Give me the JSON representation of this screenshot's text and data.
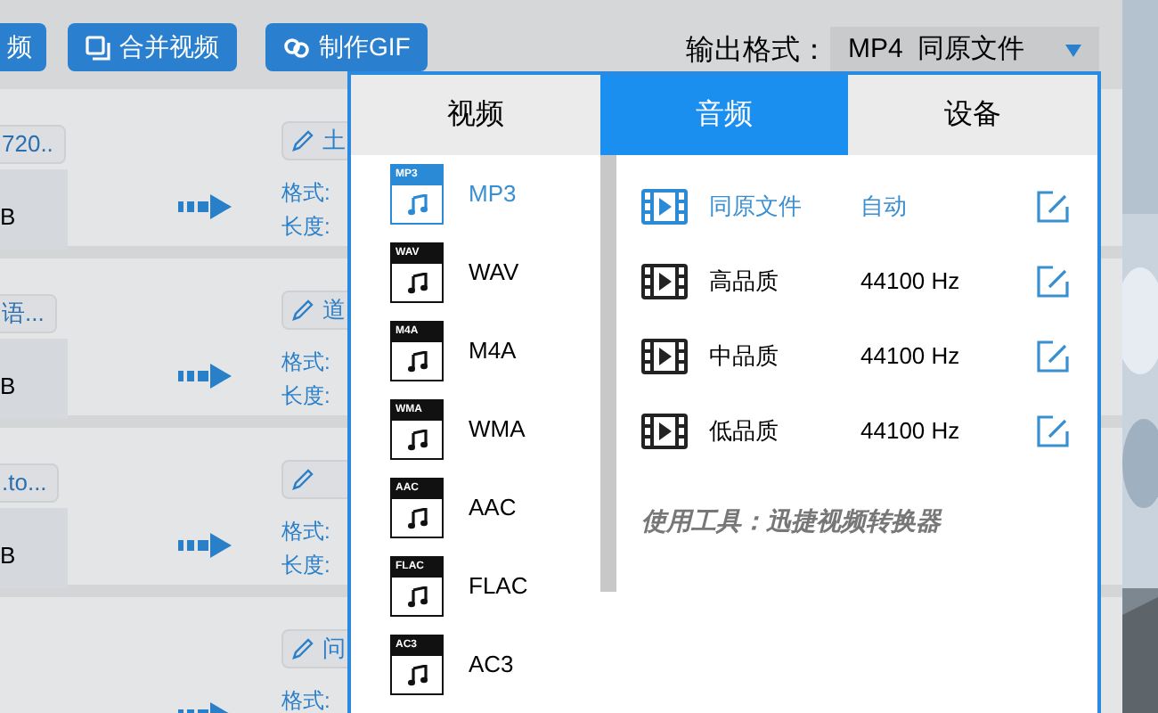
{
  "toolbar": {
    "buttons": [
      {
        "label": "频",
        "kind": "plain"
      },
      {
        "label": "合并视频",
        "kind": "merge"
      },
      {
        "label": "制作GIF",
        "kind": "gif"
      }
    ]
  },
  "output_format": {
    "label": "输出格式：",
    "value": "MP4  同原文件"
  },
  "files": [
    {
      "tag": "720..",
      "size": "B",
      "edit_label": "土",
      "format_label": "格式:",
      "length_label": "长度:"
    },
    {
      "tag": "语...",
      "size": "B",
      "edit_label": "道",
      "format_label": "格式:",
      "length_label": "长度:"
    },
    {
      "tag": ".to...",
      "size": "B",
      "format_label": "格式:",
      "length_label": "长度:"
    },
    {
      "edit_label": "问",
      "format_label": "格式:"
    }
  ],
  "popup": {
    "tabs": [
      {
        "label": "视频",
        "selected": false
      },
      {
        "label": "音频",
        "selected": true
      },
      {
        "label": "设备",
        "selected": false
      }
    ],
    "formats": [
      {
        "label": "MP3",
        "badge": "MP3",
        "selected": true
      },
      {
        "label": "WAV",
        "badge": "WAV",
        "selected": false
      },
      {
        "label": "M4A",
        "badge": "M4A",
        "selected": false
      },
      {
        "label": "WMA",
        "badge": "WMA",
        "selected": false
      },
      {
        "label": "AAC",
        "badge": "AAC",
        "selected": false
      },
      {
        "label": "FLAC",
        "badge": "FLAC",
        "selected": false
      },
      {
        "label": "AC3",
        "badge": "AC3",
        "selected": false
      }
    ],
    "presets": [
      {
        "name": "同原文件",
        "rate": "自动",
        "selected": true
      },
      {
        "name": "高品质",
        "rate": "44100 Hz",
        "selected": false
      },
      {
        "name": "中品质",
        "rate": "44100 Hz",
        "selected": false
      },
      {
        "name": "低品质",
        "rate": "44100 Hz",
        "selected": false
      }
    ],
    "footer": "使用工具：迅捷视频转换器"
  }
}
